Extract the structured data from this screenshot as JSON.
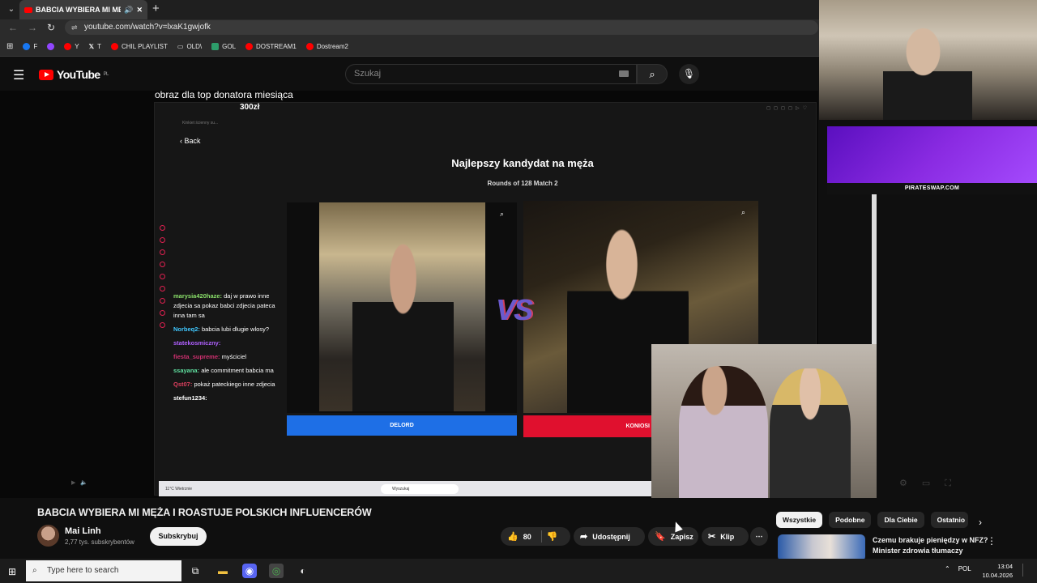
{
  "browser": {
    "tab_title": "BABCIA WYBIERA MI MĘŻA",
    "url": "youtube.com/watch?v=lxaK1gwjofk",
    "bookmarks": [
      {
        "label": "F",
        "color": "#1877f2"
      },
      {
        "label": "",
        "color": "#9146ff"
      },
      {
        "label": "Y",
        "color": "#ff0000"
      },
      {
        "label": "T",
        "color": "#ffffff"
      },
      {
        "label": "CHIL PLAYLIST",
        "color": "#ff0000"
      },
      {
        "label": "OLD\\",
        "color": "#cccccc"
      },
      {
        "label": "GOL",
        "color": "#2d9c6a"
      },
      {
        "label": "DOSTREAM1",
        "color": "#ff0000"
      },
      {
        "label": "Dostream2",
        "color": "#ff0000"
      }
    ]
  },
  "youtube": {
    "logo": "YouTube",
    "region": "PL",
    "search_placeholder": "Szukaj"
  },
  "video_content": {
    "overlay_text": "obraz dla top donatora miesiąca",
    "overlay_amount": "300zł",
    "back_label": "Back",
    "game_title": "Najlepszy kandydat na męża",
    "round_info": "Rounds of 128 Match 2",
    "vs_label": "VS",
    "candidate_left": "DELORD",
    "candidate_right": "KONIOSI",
    "inner_search": "Wyszukaj",
    "inner_weather": "11°C Wietrznie",
    "chat": [
      {
        "user": "marysia420haze:",
        "text": "daj w prawo inne zdjecia sa pokaz babci zdjecia pateca inna tam sa"
      },
      {
        "user": "Norbeq2:",
        "text": "babcia lubi dlugie wlosy?"
      },
      {
        "user": "statekosmiczny:",
        "text": ""
      },
      {
        "user": "fiesta_supreme:",
        "text": "myściciel"
      },
      {
        "user": "ssayana:",
        "text": "ale commitment babcia ma"
      },
      {
        "user": "Qst07:",
        "text": "pokaż pateckiego inne zdjecia"
      },
      {
        "user": "stefun1234:",
        "text": ""
      }
    ],
    "banner_site": "PIRATESWAP.COM"
  },
  "video_meta": {
    "title": "BABCIA WYBIERA MI MĘŻA I ROASTUJE POLSKICH INFLUENCERÓW",
    "channel": "Mai Linh",
    "subscribers": "2,77 tys. subskrybentów",
    "subscribe_label": "Subskrybuj",
    "likes": "80",
    "share_label": "Udostępnij",
    "save_label": "Zapisz",
    "clip_label": "Klip"
  },
  "sidebar": {
    "chips": [
      "Wszystkie",
      "Podobne",
      "Dla Ciebie",
      "Ostatnio"
    ],
    "active_chip": "Wszystkie",
    "rec_title": "Czemu brakuje pieniędzy w NFZ? Minister zdrowia tłumaczy"
  },
  "taskbar": {
    "search_placeholder": "Type here to search",
    "lang": "POL",
    "time": "13:04",
    "date": "10.04.2026"
  }
}
